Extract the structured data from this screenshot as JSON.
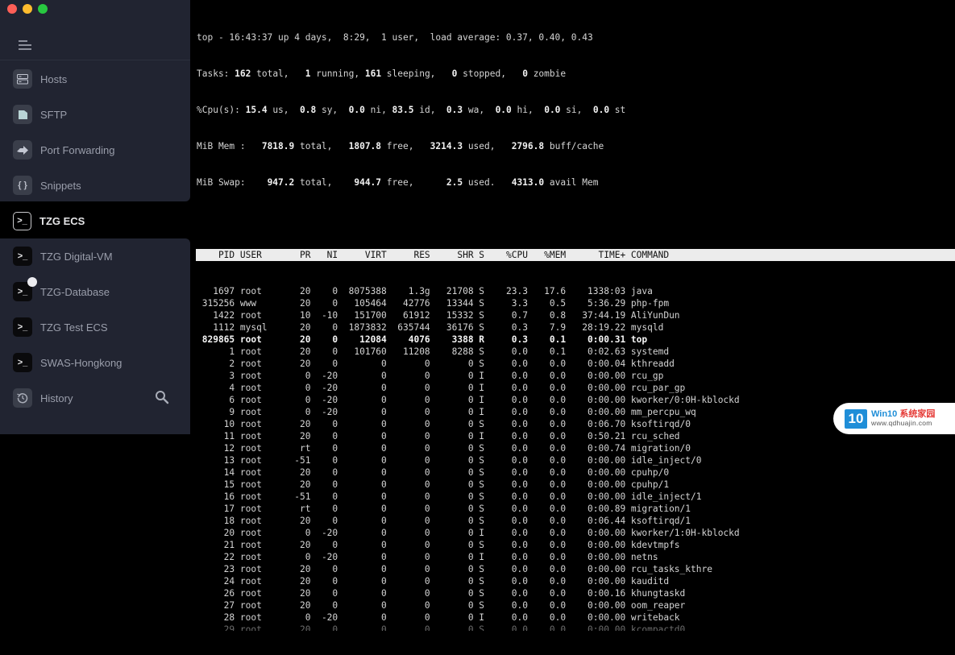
{
  "window": {
    "controls": [
      "close",
      "minimize",
      "maximize"
    ]
  },
  "sidebar": {
    "menu_icon": "hamburger-icon",
    "nav": [
      {
        "label": "Hosts",
        "icon": "server-icon"
      },
      {
        "label": "SFTP",
        "icon": "folder-icon"
      },
      {
        "label": "Port Forwarding",
        "icon": "forward-arrow-icon"
      },
      {
        "label": "Snippets",
        "icon": "braces-icon",
        "glyph": "{ }"
      }
    ],
    "active_host": {
      "label": "TZG ECS",
      "icon": "terminal-icon",
      "glyph": ">_"
    },
    "hosts": [
      {
        "label": "TZG Digital-VM",
        "icon": "terminal-icon",
        "glyph": ">_",
        "badge": false
      },
      {
        "label": "TZG-Database",
        "icon": "terminal-icon",
        "glyph": ">_",
        "badge": true
      },
      {
        "label": "TZG Test ECS",
        "icon": "terminal-icon",
        "glyph": ">_",
        "badge": false
      },
      {
        "label": "SWAS-Hongkong",
        "icon": "terminal-icon",
        "glyph": ">_",
        "badge": false
      }
    ],
    "history": {
      "label": "History",
      "icon": "history-icon"
    },
    "search_icon": "search-icon"
  },
  "terminal": {
    "summary": {
      "line1": "top - 16:43:37 up 4 days,  8:29,  1 user,  load average: 0.37, 0.40, 0.43",
      "tasks": {
        "total": "162",
        "running": "1",
        "sleeping": "161",
        "stopped": "0",
        "zombie": "0"
      },
      "cpu": {
        "us": "15.4",
        "sy": "0.8",
        "ni": "0.0",
        "id": "83.5",
        "wa": "0.3",
        "hi": "0.0",
        "si": "0.0",
        "st": "0.0"
      },
      "mem": {
        "total": "7818.9",
        "free": "1807.8",
        "used": "3214.3",
        "buff_cache": "2796.8"
      },
      "swap": {
        "total": "947.2",
        "free": "944.7",
        "used": "2.5",
        "avail_mem": "4313.0"
      }
    },
    "columns": [
      "PID",
      "USER",
      "PR",
      "NI",
      "VIRT",
      "RES",
      "SHR",
      "S",
      "%CPU",
      "%MEM",
      "TIME+",
      "COMMAND"
    ],
    "processes": [
      {
        "pid": "1697",
        "user": "root",
        "pr": "20",
        "ni": "0",
        "virt": "8075388",
        "res": "1.3g",
        "shr": "21708",
        "s": "S",
        "cpu": "23.3",
        "mem": "17.6",
        "time": "1338:03",
        "cmd": "java"
      },
      {
        "pid": "315256",
        "user": "www",
        "pr": "20",
        "ni": "0",
        "virt": "105464",
        "res": "42776",
        "shr": "13344",
        "s": "S",
        "cpu": "3.3",
        "mem": "0.5",
        "time": "5:36.29",
        "cmd": "php-fpm"
      },
      {
        "pid": "1422",
        "user": "root",
        "pr": "10",
        "ni": "-10",
        "virt": "151700",
        "res": "61912",
        "shr": "15332",
        "s": "S",
        "cpu": "0.7",
        "mem": "0.8",
        "time": "37:44.19",
        "cmd": "AliYunDun"
      },
      {
        "pid": "1112",
        "user": "mysql",
        "pr": "20",
        "ni": "0",
        "virt": "1873832",
        "res": "635744",
        "shr": "36176",
        "s": "S",
        "cpu": "0.3",
        "mem": "7.9",
        "time": "28:19.22",
        "cmd": "mysqld"
      },
      {
        "pid": "829865",
        "user": "root",
        "pr": "20",
        "ni": "0",
        "virt": "12084",
        "res": "4076",
        "shr": "3388",
        "s": "R",
        "cpu": "0.3",
        "mem": "0.1",
        "time": "0:00.31",
        "cmd": "top",
        "bold": true
      },
      {
        "pid": "1",
        "user": "root",
        "pr": "20",
        "ni": "0",
        "virt": "101760",
        "res": "11208",
        "shr": "8288",
        "s": "S",
        "cpu": "0.0",
        "mem": "0.1",
        "time": "0:02.63",
        "cmd": "systemd"
      },
      {
        "pid": "2",
        "user": "root",
        "pr": "20",
        "ni": "0",
        "virt": "0",
        "res": "0",
        "shr": "0",
        "s": "S",
        "cpu": "0.0",
        "mem": "0.0",
        "time": "0:00.04",
        "cmd": "kthreadd"
      },
      {
        "pid": "3",
        "user": "root",
        "pr": "0",
        "ni": "-20",
        "virt": "0",
        "res": "0",
        "shr": "0",
        "s": "I",
        "cpu": "0.0",
        "mem": "0.0",
        "time": "0:00.00",
        "cmd": "rcu_gp"
      },
      {
        "pid": "4",
        "user": "root",
        "pr": "0",
        "ni": "-20",
        "virt": "0",
        "res": "0",
        "shr": "0",
        "s": "I",
        "cpu": "0.0",
        "mem": "0.0",
        "time": "0:00.00",
        "cmd": "rcu_par_gp"
      },
      {
        "pid": "6",
        "user": "root",
        "pr": "0",
        "ni": "-20",
        "virt": "0",
        "res": "0",
        "shr": "0",
        "s": "I",
        "cpu": "0.0",
        "mem": "0.0",
        "time": "0:00.00",
        "cmd": "kworker/0:0H-kblockd"
      },
      {
        "pid": "9",
        "user": "root",
        "pr": "0",
        "ni": "-20",
        "virt": "0",
        "res": "0",
        "shr": "0",
        "s": "I",
        "cpu": "0.0",
        "mem": "0.0",
        "time": "0:00.00",
        "cmd": "mm_percpu_wq"
      },
      {
        "pid": "10",
        "user": "root",
        "pr": "20",
        "ni": "0",
        "virt": "0",
        "res": "0",
        "shr": "0",
        "s": "S",
        "cpu": "0.0",
        "mem": "0.0",
        "time": "0:06.70",
        "cmd": "ksoftirqd/0"
      },
      {
        "pid": "11",
        "user": "root",
        "pr": "20",
        "ni": "0",
        "virt": "0",
        "res": "0",
        "shr": "0",
        "s": "I",
        "cpu": "0.0",
        "mem": "0.0",
        "time": "0:50.21",
        "cmd": "rcu_sched"
      },
      {
        "pid": "12",
        "user": "root",
        "pr": "rt",
        "ni": "0",
        "virt": "0",
        "res": "0",
        "shr": "0",
        "s": "S",
        "cpu": "0.0",
        "mem": "0.0",
        "time": "0:00.74",
        "cmd": "migration/0"
      },
      {
        "pid": "13",
        "user": "root",
        "pr": "-51",
        "ni": "0",
        "virt": "0",
        "res": "0",
        "shr": "0",
        "s": "S",
        "cpu": "0.0",
        "mem": "0.0",
        "time": "0:00.00",
        "cmd": "idle_inject/0"
      },
      {
        "pid": "14",
        "user": "root",
        "pr": "20",
        "ni": "0",
        "virt": "0",
        "res": "0",
        "shr": "0",
        "s": "S",
        "cpu": "0.0",
        "mem": "0.0",
        "time": "0:00.00",
        "cmd": "cpuhp/0"
      },
      {
        "pid": "15",
        "user": "root",
        "pr": "20",
        "ni": "0",
        "virt": "0",
        "res": "0",
        "shr": "0",
        "s": "S",
        "cpu": "0.0",
        "mem": "0.0",
        "time": "0:00.00",
        "cmd": "cpuhp/1"
      },
      {
        "pid": "16",
        "user": "root",
        "pr": "-51",
        "ni": "0",
        "virt": "0",
        "res": "0",
        "shr": "0",
        "s": "S",
        "cpu": "0.0",
        "mem": "0.0",
        "time": "0:00.00",
        "cmd": "idle_inject/1"
      },
      {
        "pid": "17",
        "user": "root",
        "pr": "rt",
        "ni": "0",
        "virt": "0",
        "res": "0",
        "shr": "0",
        "s": "S",
        "cpu": "0.0",
        "mem": "0.0",
        "time": "0:00.89",
        "cmd": "migration/1"
      },
      {
        "pid": "18",
        "user": "root",
        "pr": "20",
        "ni": "0",
        "virt": "0",
        "res": "0",
        "shr": "0",
        "s": "S",
        "cpu": "0.0",
        "mem": "0.0",
        "time": "0:06.44",
        "cmd": "ksoftirqd/1"
      },
      {
        "pid": "20",
        "user": "root",
        "pr": "0",
        "ni": "-20",
        "virt": "0",
        "res": "0",
        "shr": "0",
        "s": "I",
        "cpu": "0.0",
        "mem": "0.0",
        "time": "0:00.00",
        "cmd": "kworker/1:0H-kblockd"
      },
      {
        "pid": "21",
        "user": "root",
        "pr": "20",
        "ni": "0",
        "virt": "0",
        "res": "0",
        "shr": "0",
        "s": "S",
        "cpu": "0.0",
        "mem": "0.0",
        "time": "0:00.00",
        "cmd": "kdevtmpfs"
      },
      {
        "pid": "22",
        "user": "root",
        "pr": "0",
        "ni": "-20",
        "virt": "0",
        "res": "0",
        "shr": "0",
        "s": "I",
        "cpu": "0.0",
        "mem": "0.0",
        "time": "0:00.00",
        "cmd": "netns"
      },
      {
        "pid": "23",
        "user": "root",
        "pr": "20",
        "ni": "0",
        "virt": "0",
        "res": "0",
        "shr": "0",
        "s": "S",
        "cpu": "0.0",
        "mem": "0.0",
        "time": "0:00.00",
        "cmd": "rcu_tasks_kthre"
      },
      {
        "pid": "24",
        "user": "root",
        "pr": "20",
        "ni": "0",
        "virt": "0",
        "res": "0",
        "shr": "0",
        "s": "S",
        "cpu": "0.0",
        "mem": "0.0",
        "time": "0:00.00",
        "cmd": "kauditd"
      },
      {
        "pid": "26",
        "user": "root",
        "pr": "20",
        "ni": "0",
        "virt": "0",
        "res": "0",
        "shr": "0",
        "s": "S",
        "cpu": "0.0",
        "mem": "0.0",
        "time": "0:00.16",
        "cmd": "khungtaskd"
      },
      {
        "pid": "27",
        "user": "root",
        "pr": "20",
        "ni": "0",
        "virt": "0",
        "res": "0",
        "shr": "0",
        "s": "S",
        "cpu": "0.0",
        "mem": "0.0",
        "time": "0:00.00",
        "cmd": "oom_reaper"
      },
      {
        "pid": "28",
        "user": "root",
        "pr": "0",
        "ni": "-20",
        "virt": "0",
        "res": "0",
        "shr": "0",
        "s": "I",
        "cpu": "0.0",
        "mem": "0.0",
        "time": "0:00.00",
        "cmd": "writeback"
      },
      {
        "pid": "29",
        "user": "root",
        "pr": "20",
        "ni": "0",
        "virt": "0",
        "res": "0",
        "shr": "0",
        "s": "S",
        "cpu": "0.0",
        "mem": "0.0",
        "time": "0:00.00",
        "cmd": "kcompactd0",
        "partial": true
      }
    ]
  },
  "watermark": {
    "logo": "10",
    "title_en": "Win10",
    "title_cn": "系统家园",
    "url": "www.qdhuajin.com"
  }
}
